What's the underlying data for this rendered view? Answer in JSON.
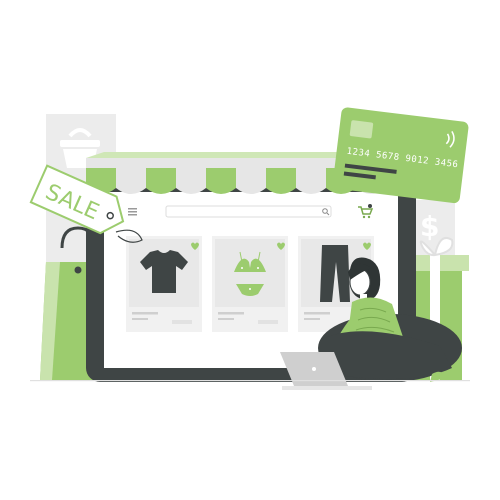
{
  "sale_tag": {
    "text": "SALE"
  },
  "credit_card": {
    "number": "1234 5678 9012 3456"
  },
  "colors": {
    "accent": "#9ccc6e",
    "accent_dark": "#79a94f",
    "accent_light": "#c9e3ad",
    "dark": "#3f4545",
    "gray": "#e6e6e6",
    "gray_mid": "#cfcfcf",
    "screen": "#ffffff"
  },
  "icons": [
    "menu-icon",
    "search-icon",
    "cart-icon",
    "heart-icon",
    "shopping-basket-icon",
    "contactless-icon",
    "dollar-sign-icon"
  ]
}
